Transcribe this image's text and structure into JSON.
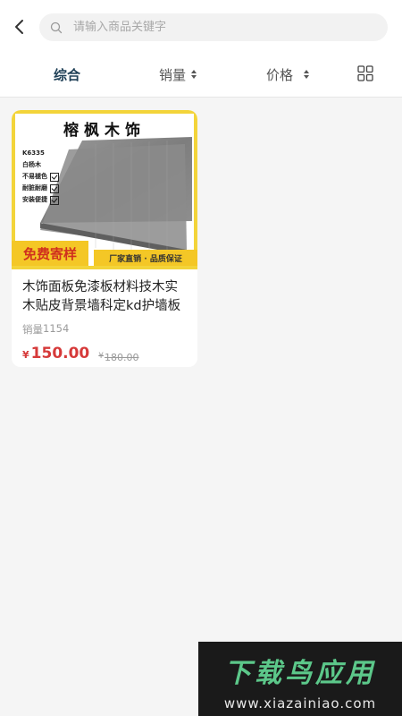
{
  "header": {
    "search": {
      "placeholder": "请输入商品关键字",
      "value": ""
    }
  },
  "tabs": [
    {
      "label": "综合",
      "active": true
    },
    {
      "label": "销量",
      "active": false
    },
    {
      "label": "价格",
      "active": false
    }
  ],
  "product": {
    "image": {
      "brand": "榕枫木饰",
      "specs": [
        "K6335",
        "白杨木",
        "不易褪色",
        "耐脏耐磨",
        "安装便捷"
      ],
      "free_tag": "免费寄样",
      "guarantee": "厂家直销 · 品质保证"
    },
    "title": "木饰面板免漆板材料技木实木贴皮背景墙科定kd护墙板",
    "sales_label": "销量",
    "sales_count": "1154",
    "currency": "¥",
    "price": "150.00",
    "original_price": "180.00"
  },
  "watermark": {
    "title": "下载鸟应用",
    "url": "www.xiazainiao.com"
  },
  "colors": {
    "accent": "#1e3f56",
    "price": "#d63a3a",
    "tag_yellow": "#f4c726"
  }
}
